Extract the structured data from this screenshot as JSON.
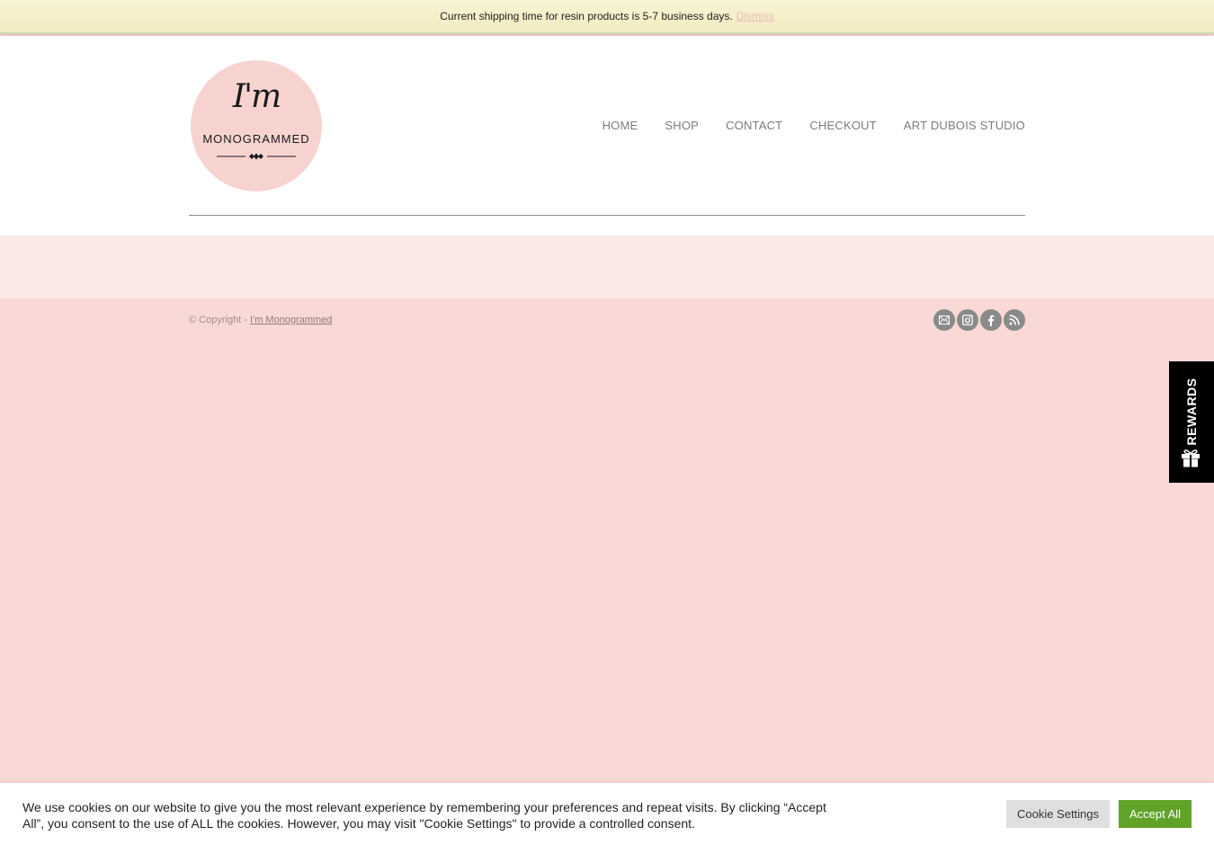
{
  "notice": {
    "text": "Current shipping time for resin products is 5-7 business days.",
    "dismiss_label": "Dismiss"
  },
  "logo": {
    "script_text": "I'm",
    "word_text": "MONOGRAMMED"
  },
  "nav": {
    "items": [
      {
        "label": "HOME"
      },
      {
        "label": "SHOP"
      },
      {
        "label": "CONTACT"
      },
      {
        "label": "CHECKOUT"
      },
      {
        "label": "ART DUBOIS STUDIO"
      }
    ]
  },
  "footer": {
    "copyright_prefix": "© Copyright -",
    "copyright_link": "I'm Monogrammed",
    "social_icons": [
      "mail-icon",
      "instagram-icon",
      "facebook-icon",
      "rss-icon"
    ]
  },
  "rewards": {
    "label": "REWARDS",
    "icon": "gift-icon"
  },
  "cookie": {
    "message": "We use cookies on our website to give you the most relevant experience by remembering your preferences and repeat visits. By clicking “Accept All”, you consent to the use of ALL the cookies. However, you may visit \"Cookie Settings\" to provide a controlled consent.",
    "settings_label": "Cookie Settings",
    "accept_label": "Accept All"
  },
  "colors": {
    "page_background": "#f8d9d6",
    "band_background": "#fbe9e5",
    "notice_background": "#f5efcb",
    "logo_circle": "#f7d3d0",
    "accept_button": "#61a229",
    "rewards_tab": "#000000"
  }
}
